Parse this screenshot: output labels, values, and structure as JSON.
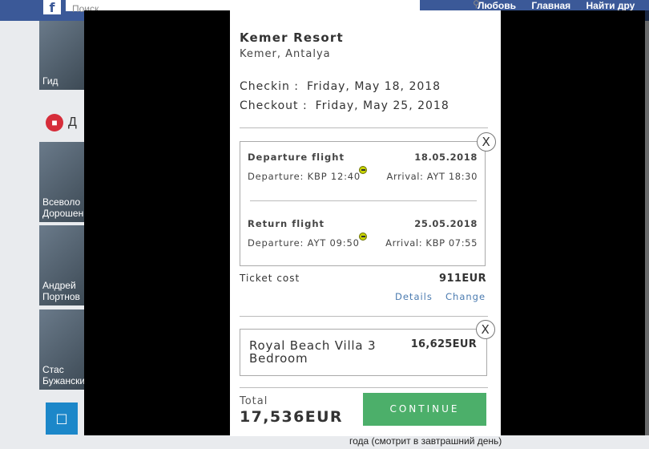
{
  "background": {
    "search_placeholder": "Поиск",
    "nav_items": [
      "Любовь",
      "Главная",
      "Найти дру"
    ],
    "section_title": "Д",
    "thumbs": [
      {
        "text": "Гид"
      },
      {
        "text": "Всеволо Дорошен"
      },
      {
        "text": "Андрей Портнов"
      },
      {
        "text": "Стас Бужански"
      }
    ],
    "footer_text": "года (смотрит в завтрашний день)"
  },
  "booking": {
    "hotel_name": "Kemer Resort",
    "hotel_location": "Kemer, Antalya",
    "checkin_label": "Checkin :",
    "checkin_value": "Friday, May 18, 2018",
    "checkout_label": "Checkout :",
    "checkout_value": "Friday, May 25, 2018",
    "flights": [
      {
        "title": "Departure flight",
        "date": "18.05.2018",
        "departure": "Departure: KBP 12:40",
        "arrival": "Arrival: AYT 18:30"
      },
      {
        "title": "Return flight",
        "date": "25.05.2018",
        "departure": "Departure: AYT 09:50",
        "arrival": "Arrival: KBP 07:55"
      }
    ],
    "ticket_cost_label": "Ticket cost",
    "ticket_cost_value": "911EUR",
    "details_link": "Details",
    "change_link": "Change",
    "room_name": "Royal Beach Villa 3 Bedroom",
    "room_price": "16,625EUR",
    "total_label": "Total",
    "total_value": "17,536EUR",
    "continue_label": "CONTINUE",
    "close_symbol": "X"
  },
  "colors": {
    "accent_green": "#4caf6a",
    "link_blue": "#4b7bb0"
  }
}
